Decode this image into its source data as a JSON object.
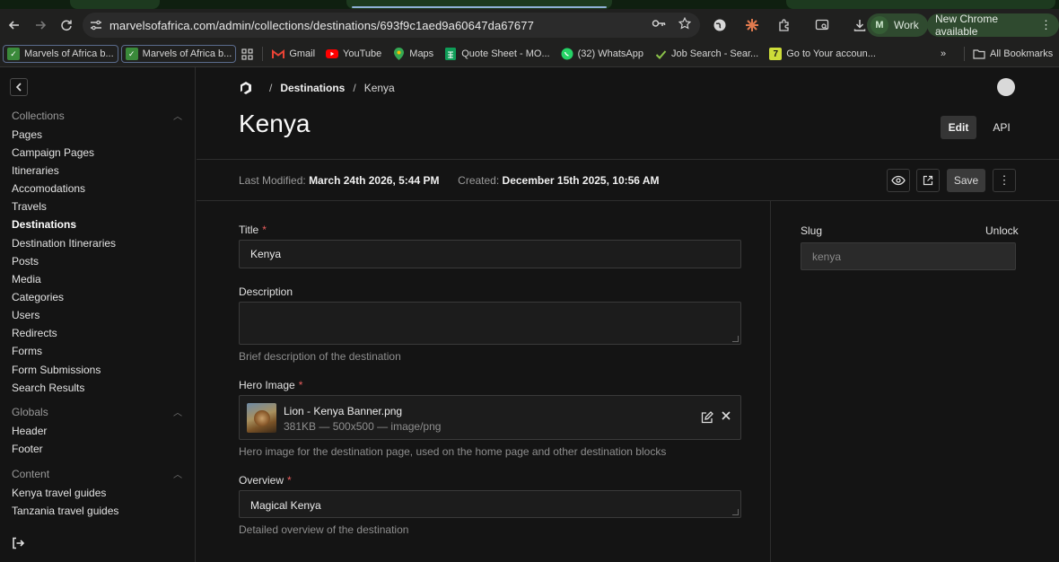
{
  "browser": {
    "url_host": "marvelsofafrica.com",
    "url_path": "/admin/collections/destinations/693f9c1aed9a60647da67677",
    "profile_initial": "M",
    "profile_label": "Work",
    "update_label": "New Chrome available"
  },
  "bookmarks": [
    {
      "icon": "check-icon",
      "label": "Marvels of Africa b..."
    },
    {
      "icon": "check-icon",
      "label": "Marvels of Africa b..."
    },
    {
      "icon": "gmail-icon",
      "label": "Gmail"
    },
    {
      "icon": "youtube-icon",
      "label": "YouTube"
    },
    {
      "icon": "maps-icon",
      "label": "Maps"
    },
    {
      "icon": "sheets-icon",
      "label": "Quote Sheet - MO..."
    },
    {
      "icon": "whatsapp-icon",
      "label": "(32) WhatsApp"
    },
    {
      "icon": "check-icon",
      "label": "Job Search - Sear..."
    },
    {
      "icon": "seven-icon",
      "label": "Go to Your accoun..."
    }
  ],
  "bookmarks_all_label": "All Bookmarks",
  "sidebar": {
    "groups": [
      {
        "label": "Collections",
        "items": [
          "Pages",
          "Campaign Pages",
          "Itineraries",
          "Accomodations",
          "Travels",
          "Destinations",
          "Destination Itineraries",
          "Posts",
          "Media",
          "Categories",
          "Users",
          "Redirects",
          "Forms",
          "Form Submissions",
          "Search Results"
        ]
      },
      {
        "label": "Globals",
        "items": [
          "Header",
          "Footer"
        ]
      },
      {
        "label": "Content",
        "items": [
          "Kenya travel guides",
          "Tanzania travel guides"
        ]
      }
    ],
    "active_item": "Destinations"
  },
  "breadcrumb": {
    "section": "Destinations",
    "current": "Kenya"
  },
  "page": {
    "title": "Kenya",
    "tab_edit": "Edit",
    "tab_api": "API"
  },
  "meta": {
    "modified_label": "Last Modified:",
    "modified_value": "March 24th 2026, 5:44 PM",
    "created_label": "Created:",
    "created_value": "December 15th 2025, 10:56 AM",
    "save_label": "Save"
  },
  "form": {
    "title": {
      "label": "Title",
      "value": "Kenya"
    },
    "description": {
      "label": "Description",
      "value": "",
      "help": "Brief description of the destination"
    },
    "hero_image": {
      "label": "Hero Image",
      "file_name": "Lion - Kenya Banner.png",
      "file_meta": "381KB — 500x500 — image/png",
      "help": "Hero image for the destination page, used on the home page and other destination blocks"
    },
    "overview": {
      "label": "Overview",
      "value": "Magical Kenya",
      "help": "Detailed overview of the destination"
    },
    "slug": {
      "label": "Slug",
      "unlock_label": "Unlock",
      "value": "kenya"
    }
  }
}
